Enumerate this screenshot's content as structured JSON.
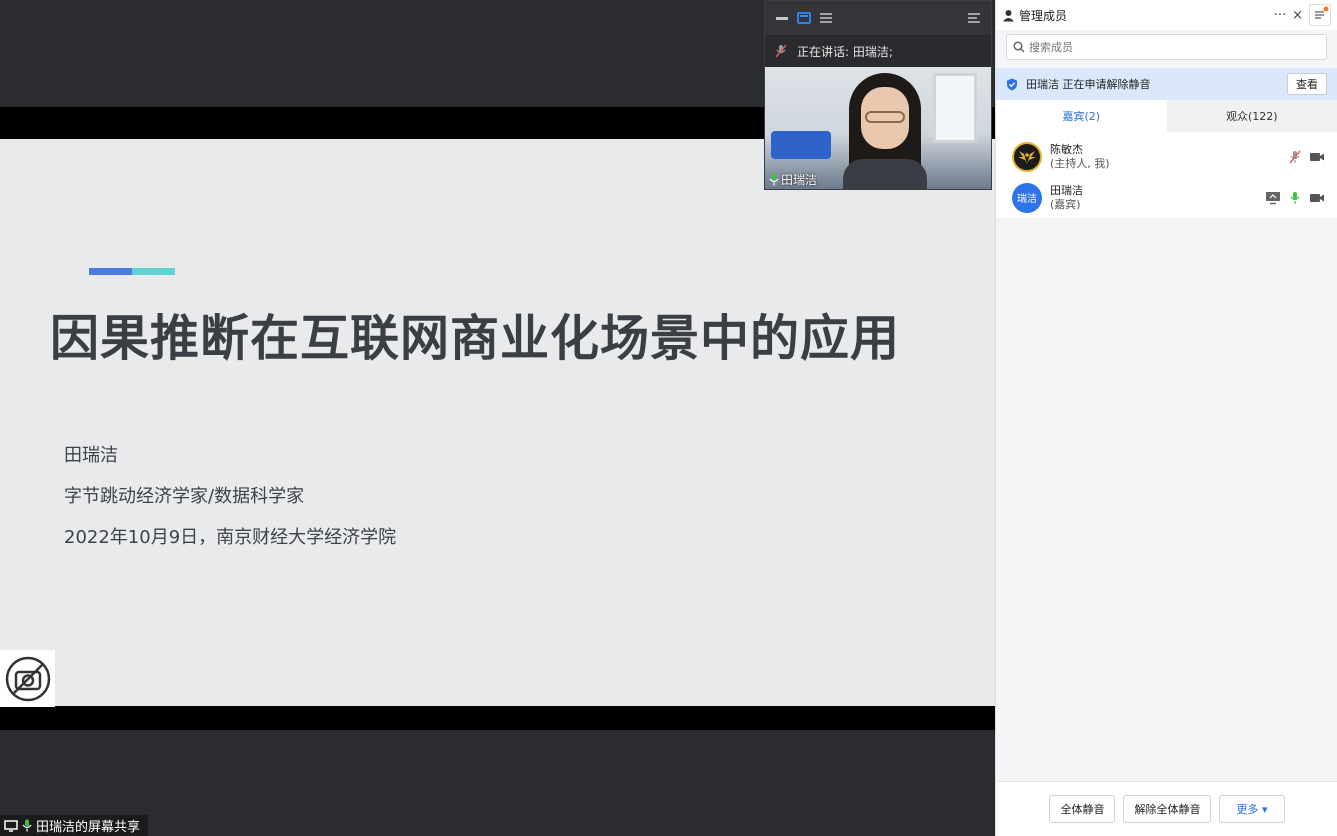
{
  "slide": {
    "title": "因果推断在互联网商业化场景中的应用",
    "author": "田瑞洁",
    "role": "字节跳动经济学家/数据科学家",
    "date_place": "2022年10月9日，南京财经大学经济学院"
  },
  "share_label": "田瑞洁的屏幕共享",
  "video_panel": {
    "speaking": "正在讲话: 田瑞洁;",
    "participant_name": "田瑞洁"
  },
  "members_panel": {
    "title": "管理成员",
    "more": "···",
    "close": "×",
    "search_placeholder": "搜索成员",
    "alert_text": "田瑞洁 正在申请解除静音",
    "alert_button": "查看",
    "tabs": [
      {
        "label": "嘉宾(2)"
      },
      {
        "label": "观众(122)"
      }
    ],
    "members": [
      {
        "name": "陈敏杰",
        "role": "(主持人, 我)",
        "avatar": ""
      },
      {
        "name": "田瑞洁",
        "role": "(嘉宾)",
        "avatar": "瑞洁"
      }
    ],
    "footer": {
      "mute_all": "全体静音",
      "unmute_all": "解除全体静音",
      "more": "更多 ▾"
    }
  },
  "colors": {
    "accent_blue": "#2a6ed8",
    "mic_green": "#3fbf3f",
    "mic_muted_red": "#e05a5a"
  }
}
